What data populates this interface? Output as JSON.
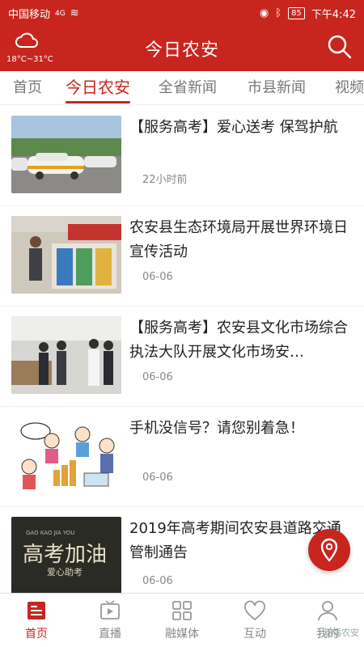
{
  "status_bar": {
    "carrier": "中国移动",
    "signal": "4G",
    "battery": "85",
    "time": "下午4:42"
  },
  "header": {
    "title": "今日农安",
    "weather_temp": "18°C~31°C",
    "weather_icon": "cloud-icon",
    "search_icon": "search-icon"
  },
  "tabs": [
    {
      "label": "首页",
      "active": false
    },
    {
      "label": "今日农安",
      "active": true
    },
    {
      "label": "全省新闻",
      "active": false
    },
    {
      "label": "市县新闻",
      "active": false
    },
    {
      "label": "视频",
      "active": false
    }
  ],
  "news": [
    {
      "title": "【服务高考】爱心送考 保驾护航",
      "time": "22小时前"
    },
    {
      "title": "农安县生态环境局开展世界环境日宣传活动",
      "time": "06-06"
    },
    {
      "title": "【服务高考】农安县文化市场综合执法大队开展文化市场安…",
      "time": "06-06"
    },
    {
      "title": "手机没信号？请您别着急！",
      "time": "06-06"
    },
    {
      "title": "2019年高考期间农安县道路交通管制通告",
      "time": "06-06"
    }
  ],
  "thumb_text": {
    "gaokao_main": "高考加油",
    "gaokao_pinyin": "GAO KAO JIA YOU",
    "gaokao_sub": "爱心助考"
  },
  "bottom_nav": [
    {
      "label": "首页",
      "icon": "newspaper-icon",
      "active": true
    },
    {
      "label": "直播",
      "icon": "live-play-icon",
      "active": false
    },
    {
      "label": "融媒体",
      "icon": "grid-icon",
      "active": false
    },
    {
      "label": "互动",
      "icon": "heart-icon",
      "active": false
    },
    {
      "label": "我的",
      "icon": "user-icon",
      "active": false
    }
  ],
  "watermark": "幸福农安",
  "colors": {
    "brand": "#c8251f"
  }
}
